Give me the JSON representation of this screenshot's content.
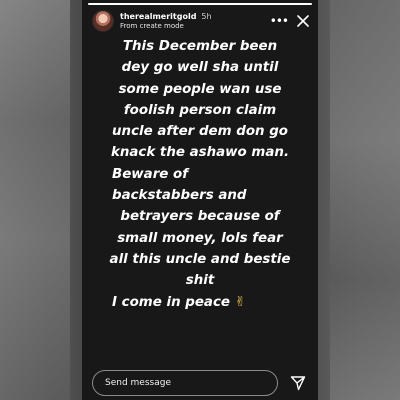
{
  "story": {
    "username": "therealmeritgold",
    "time": "5h",
    "mode_label": "From create mode",
    "more_label": "•••",
    "progress": 1.0,
    "lines": [
      "This December been",
      "dey go well sha until",
      "some people wan use",
      "foolish person claim",
      "uncle after dem don go",
      "knack the ashawo man.",
      "Beware of",
      "backstabbers and",
      "betrayers because of",
      "small money, lols fear",
      "all this uncle and bestie",
      "shit",
      "I come in peace"
    ],
    "emoji": "✌"
  },
  "footer": {
    "send_placeholder": "Send message"
  },
  "colors": {
    "story_bg": "#181818",
    "text": "#ffffff"
  },
  "icons": {
    "more": "more-horizontal-icon",
    "close": "close-icon",
    "send": "send-paper-plane-icon"
  }
}
